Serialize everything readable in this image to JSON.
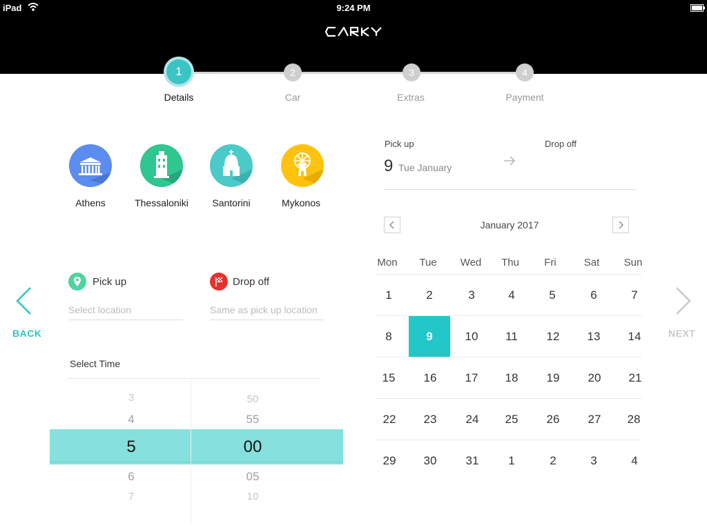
{
  "status": {
    "device": "iPad",
    "time": "9:24 PM"
  },
  "brand": {
    "logo_text": "CARKY"
  },
  "steps": [
    {
      "number": "1",
      "label": "Details",
      "active": true
    },
    {
      "number": "2",
      "label": "Car",
      "active": false
    },
    {
      "number": "3",
      "label": "Extras",
      "active": false
    },
    {
      "number": "4",
      "label": "Payment",
      "active": false
    }
  ],
  "cities": [
    {
      "name": "Athens",
      "icon": "parthenon-icon",
      "color": "#5b8cf0"
    },
    {
      "name": "Thessaloniki",
      "icon": "white-tower-icon",
      "color": "#2fc690"
    },
    {
      "name": "Santorini",
      "icon": "church-dome-icon",
      "color": "#4cc9c9"
    },
    {
      "name": "Mykonos",
      "icon": "windmill-icon",
      "color": "#ffc20e"
    }
  ],
  "pickup": {
    "label": "Pick up",
    "placeholder": "Select location"
  },
  "dropoff": {
    "label": "Drop off",
    "placeholder": "Same as pick up location"
  },
  "time": {
    "title": "Select Time",
    "hours": [
      "3",
      "4",
      "5",
      "6",
      "7"
    ],
    "minutes": [
      "50",
      "55",
      "00",
      "05",
      "10"
    ],
    "selected_hour": "5",
    "selected_minute": "00"
  },
  "nav": {
    "back": "BACK",
    "next": "NEXT"
  },
  "dates": {
    "pickup_label": "Pick up",
    "pickup_day": "9",
    "pickup_text": "Tue January",
    "dropoff_label": "Drop off"
  },
  "calendar": {
    "month": "January 2017",
    "weekdays": [
      "Mon",
      "Tue",
      "Wed",
      "Thu",
      "Fri",
      "Sat",
      "Sun"
    ],
    "weeks": [
      [
        "1",
        "2",
        "3",
        "4",
        "5",
        "6",
        "7"
      ],
      [
        "8",
        "9",
        "10",
        "11",
        "12",
        "13",
        "14"
      ],
      [
        "15",
        "16",
        "17",
        "18",
        "19",
        "20",
        "21"
      ],
      [
        "22",
        "23",
        "24",
        "25",
        "26",
        "27",
        "28"
      ],
      [
        "29",
        "30",
        "31",
        "1",
        "2",
        "3",
        "4"
      ]
    ],
    "selected_day": "9"
  },
  "colors": {
    "accent": "#22c8c8",
    "highlight": "#86e0dd",
    "header": "#000000"
  }
}
